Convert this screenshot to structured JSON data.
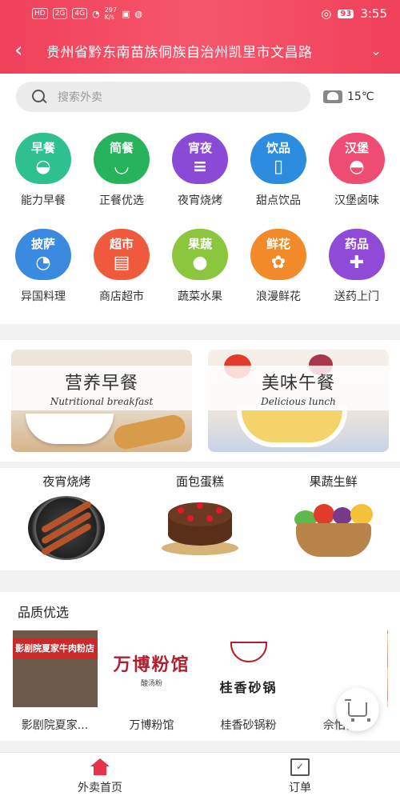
{
  "status_bar": {
    "network_labels": [
      "HD",
      "2G",
      "4G"
    ],
    "speed": "297\nK/s",
    "battery": "93",
    "time": "3:55"
  },
  "header": {
    "location": "贵州省黔东南苗族侗族自治州凯里市文昌路"
  },
  "search": {
    "placeholder": "搜索外卖",
    "weather": "15℃"
  },
  "categories": [
    {
      "tag": "早餐",
      "label": "能力早餐",
      "color": "#2ec08f",
      "glyph": "◒"
    },
    {
      "tag": "简餐",
      "label": "正餐优选",
      "color": "#27b35c",
      "glyph": "◡"
    },
    {
      "tag": "宵夜",
      "label": "夜宵烧烤",
      "color": "#8a4ad6",
      "glyph": "≡"
    },
    {
      "tag": "饮品",
      "label": "甜点饮品",
      "color": "#2c8de0",
      "glyph": "▯"
    },
    {
      "tag": "汉堡",
      "label": "汉堡卤味",
      "color": "#ef4c73",
      "glyph": "◓"
    },
    {
      "tag": "披萨",
      "label": "异国料理",
      "color": "#3a8be0",
      "glyph": "◔"
    },
    {
      "tag": "超市",
      "label": "商店超市",
      "color": "#f05a3c",
      "glyph": "▤"
    },
    {
      "tag": "果蔬",
      "label": "蔬菜水果",
      "color": "#8cc63f",
      "glyph": "●"
    },
    {
      "tag": "鲜花",
      "label": "浪漫鲜花",
      "color": "#f28a2a",
      "glyph": "✿"
    },
    {
      "tag": "药品",
      "label": "送药上门",
      "color": "#8f4ad8",
      "glyph": "✚"
    }
  ],
  "banners": [
    {
      "cn": "营养早餐",
      "en": "Nutritional breakfast"
    },
    {
      "cn": "美味午餐",
      "en": "Delicious lunch"
    }
  ],
  "trio": [
    {
      "title": "夜宵烧烤"
    },
    {
      "title": "面包蛋糕"
    },
    {
      "title": "果蔬生鲜"
    }
  ],
  "quality": {
    "title": "品质优选",
    "items": [
      {
        "name": "影剧院夏家...",
        "sign": "影剧院夏家牛肉粉店"
      },
      {
        "name": "万博粉馆",
        "logo": "万博粉馆",
        "sub": "酸汤粉"
      },
      {
        "name": "桂香砂锅粉",
        "logo": "桂香砂锅"
      },
      {
        "name": "佘怕怕..."
      }
    ]
  },
  "tabbar": {
    "home": "外卖首页",
    "orders": "订单"
  }
}
